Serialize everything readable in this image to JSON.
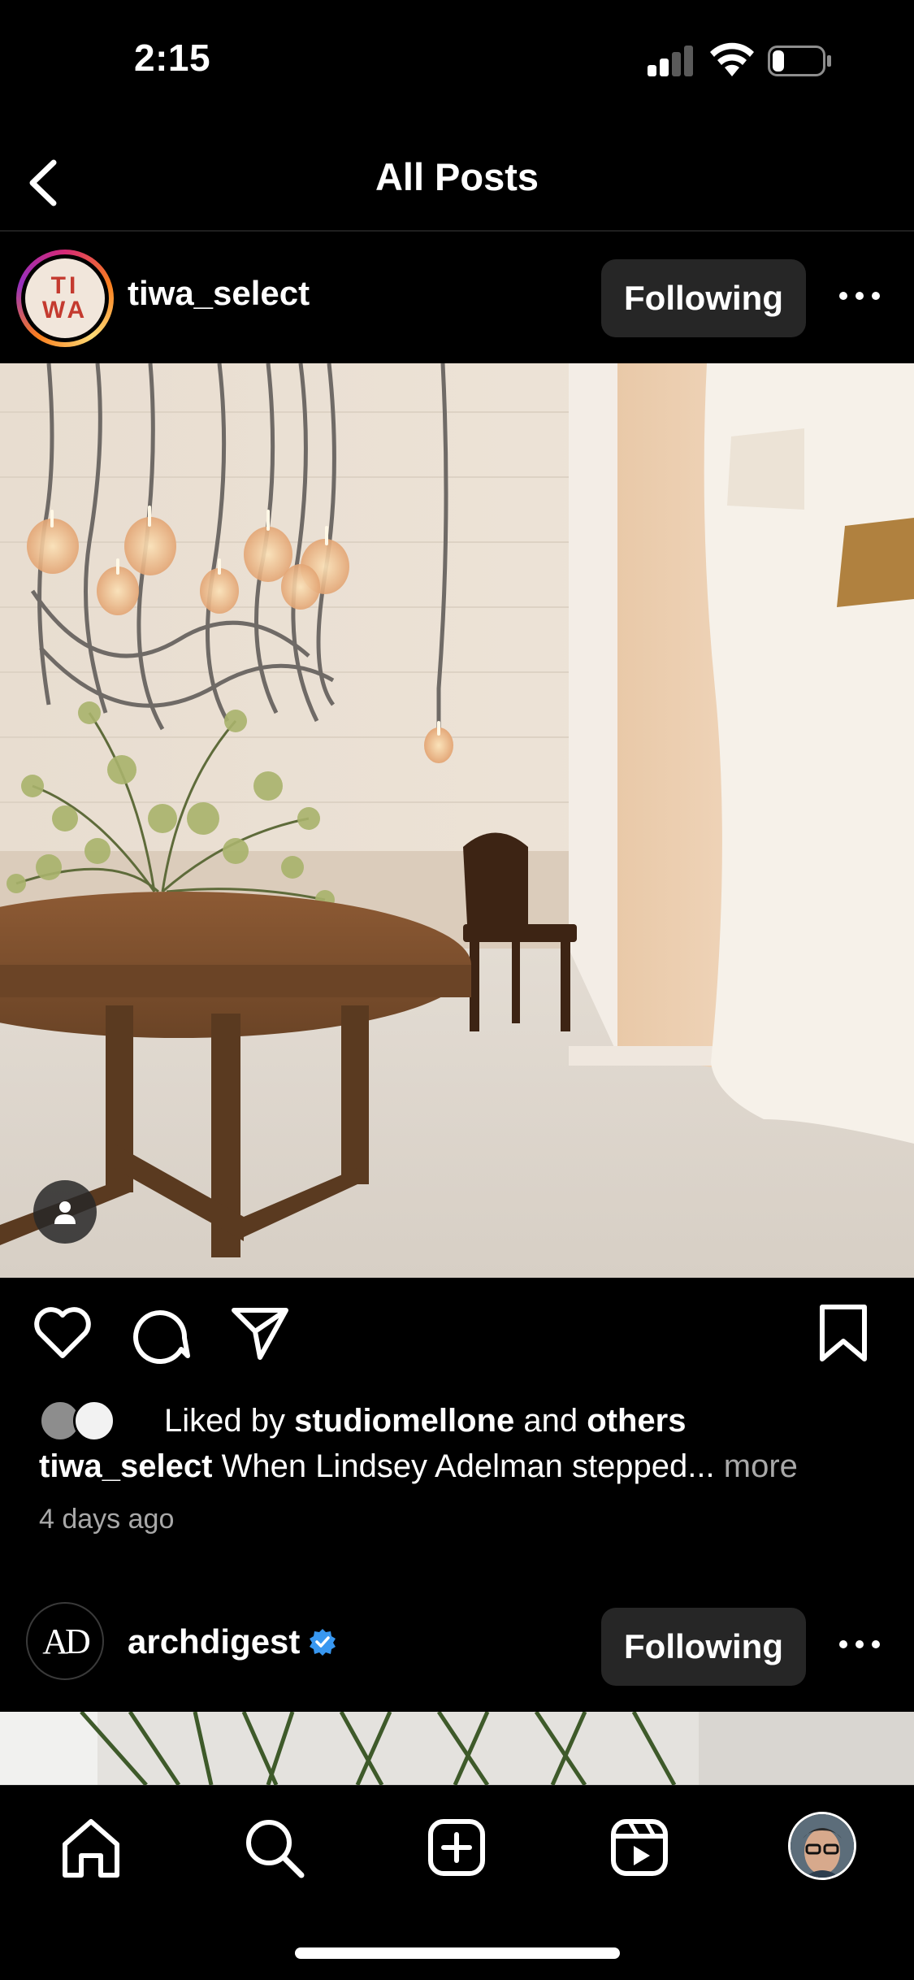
{
  "status_bar": {
    "time": "2:15",
    "signal_bars": 2,
    "battery_level": 0.2
  },
  "header": {
    "title": "All Posts",
    "back_icon": "chevron-left-icon"
  },
  "posts": [
    {
      "username": "tiwa_select",
      "avatar_text_top": "TI",
      "avatar_text_bottom": "WA",
      "follow_label": "Following",
      "verified": false,
      "liked_by_prefix": "Liked by ",
      "liked_by_user": "studiomellone",
      "liked_by_join": " and ",
      "liked_by_others": "others",
      "caption_user": "tiwa_select",
      "caption_text": " When Lindsey Adelman stepped... ",
      "caption_more": "more",
      "time_ago": "4 days ago"
    },
    {
      "username": "archdigest",
      "avatar_text": "AD",
      "follow_label": "Following",
      "verified": true
    }
  ],
  "tab_bar": {
    "items": [
      "home-icon",
      "search-icon",
      "create-icon",
      "reels-icon",
      "profile-avatar"
    ]
  },
  "colors": {
    "background": "#000000",
    "button": "#262626",
    "secondary_text": "#a8a8a8",
    "verified": "#3897f0",
    "tiwa_red": "#c43a2f"
  }
}
